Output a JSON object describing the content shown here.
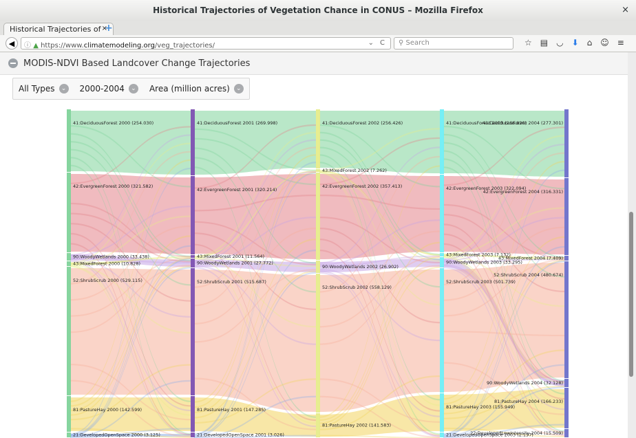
{
  "window": {
    "title": "Historical Trajectories of Vegetation Chance in CONUS – Mozilla Firefox",
    "close_glyph": "×"
  },
  "tab": {
    "label": "Historical Trajectories of ...",
    "close_glyph": "×",
    "new_glyph": "+"
  },
  "address": {
    "info_glyph": "ⓘ",
    "lock_glyph": "🔒",
    "prefix": "https://www.",
    "domain": "climatemodeling.org",
    "path": "/veg_trajectories/",
    "dropdown_glyph": "⌄",
    "reload_glyph": "C"
  },
  "search": {
    "placeholder": "Search",
    "icon_glyph": "🔍"
  },
  "toolbar_icons": [
    "star-icon",
    "reading-list-icon",
    "pocket-icon",
    "download-icon",
    "home-icon",
    "chat-icon",
    "menu-icon"
  ],
  "toolbar_glyphs": {
    "star": "☆",
    "reading": "▤",
    "pocket": "◡",
    "download": "⬇",
    "home": "⌂",
    "chat": "☺",
    "menu": "≡"
  },
  "page": {
    "title": "MODIS-NDVI Based Landcover Change Trajectories"
  },
  "filters": [
    {
      "label": "All Types",
      "glyph": "⌄"
    },
    {
      "label": "2000-2004",
      "glyph": "⌄"
    },
    {
      "label": "Area (million acres)",
      "glyph": "⌄"
    }
  ],
  "sankey": {
    "years": [
      "2000",
      "2001",
      "2002",
      "2003",
      "2004"
    ],
    "types": [
      {
        "name": "41:DeciduousForest",
        "color": "#7fd39a"
      },
      {
        "name": "43:MixedForest",
        "color": "#e8ee8a"
      },
      {
        "name": "42:EvergreenForest",
        "color": "#e3848a"
      },
      {
        "name": "90:WoodyWetlands",
        "color": "#c5a4e6"
      },
      {
        "name": "52:ShrubScrub",
        "color": "#f5b09a"
      },
      {
        "name": "81:PastureHay",
        "color": "#f2d45e"
      },
      {
        "name": "21:DevelopedOpenSpace",
        "color": "#8fb0e8"
      },
      {
        "name": "22:DevelopedLowIntensity",
        "color": "#6a78c8"
      }
    ],
    "node_labels": {
      "2000": [
        "41:DeciduousForest 2000 (254.030)",
        "42:EvergreenForest 2000 (321.582)",
        "90:WoodyWetlands 2000 (33.438)",
        "43:MixedForest 2000 (10.828)",
        "52:ShrubScrub 2000 (529.115)",
        "81:PastureHay 2000 (142.599)",
        "21:DevelopedOpenSpace 2000 (3.125)"
      ],
      "2001": [
        "41:DeciduousForest 2001 (269.998)",
        "42:EvergreenForest 2001 (320.214)",
        "43:MixedForest 2001 (11.564)",
        "90:WoodyWetlands 2001 (27.772)",
        "52:ShrubScrub 2001 (515.687)",
        "81:PastureHay 2001 (147.285)",
        "21:DevelopedOpenSpace 2001 (3.026)"
      ],
      "2002": [
        "41:DeciduousForest 2002 (256.426)",
        "43:MixedForest 2002 (7.262)",
        "42:EvergreenForest 2002 (357.413)",
        "90:WoodyWetlands 2002 (26.902)",
        "52:ShrubScrub 2002 (558.129)",
        "81:PastureHay 2002 (141.583)"
      ],
      "2003": [
        "41:DeciduousForest 2003 (266.820)",
        "42:EvergreenForest 2003 (322.094)",
        "43:MixedForest 2003 (7.132)",
        "90:WoodyWetlands 2003 (33.295)",
        "52:ShrubScrub 2003 (501.739)",
        "81:PastureHay 2003 (155.949)",
        "21:DevelopedOpenSpace 2003 (2.137)"
      ],
      "2004": [
        "41:DeciduousForest 2004 (277.301)",
        "42:EvergreenForest 2004 (316.331)",
        "43:MixedForest 2004 (7.409)",
        "52:ShrubScrub 2004 (480.674)",
        "90:WoodyWetlands 2004 (32.128)",
        "81:PastureHay 2004 (166.233)",
        "22:DevelopedLowIntensity 2004 (15.509)"
      ]
    }
  }
}
